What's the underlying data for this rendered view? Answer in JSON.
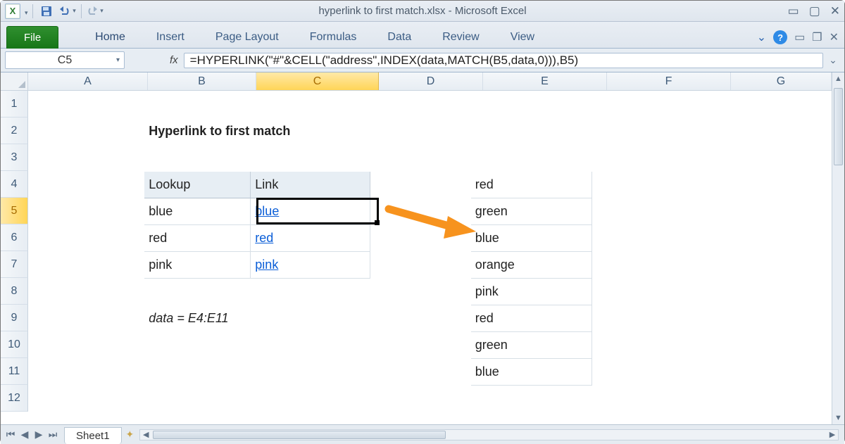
{
  "window": {
    "title": "hyperlink to first match.xlsx - Microsoft Excel"
  },
  "qat": {
    "app_letter": "X"
  },
  "ribbon": {
    "file": "File",
    "tabs": [
      "Home",
      "Insert",
      "Page Layout",
      "Formulas",
      "Data",
      "Review",
      "View"
    ]
  },
  "namebox": {
    "value": "C5"
  },
  "formula": {
    "fx": "fx",
    "value": "=HYPERLINK(\"#\"&CELL(\"address\",INDEX(data,MATCH(B5,data,0))),B5)"
  },
  "columns": [
    "A",
    "B",
    "C",
    "D",
    "E",
    "F",
    "G"
  ],
  "rows": [
    "1",
    "2",
    "3",
    "4",
    "5",
    "6",
    "7",
    "8",
    "9",
    "10",
    "11",
    "12"
  ],
  "active": {
    "col": "C",
    "row": "5"
  },
  "sheet": {
    "name": "Sheet1",
    "title": "Hyperlink to first match",
    "note": "data = E4:E11",
    "lookup_header": [
      "Lookup",
      "Link"
    ],
    "lookup_rows": [
      {
        "lookup": "blue",
        "link": "blue"
      },
      {
        "lookup": "red",
        "link": "red"
      },
      {
        "lookup": "pink",
        "link": "pink"
      }
    ],
    "data_list": [
      "red",
      "green",
      "blue",
      "orange",
      "pink",
      "red",
      "green",
      "blue"
    ]
  },
  "colors": {
    "link": "#0b5ed7",
    "arrow": "#f7931e",
    "header_fill": "#e7eef4"
  }
}
